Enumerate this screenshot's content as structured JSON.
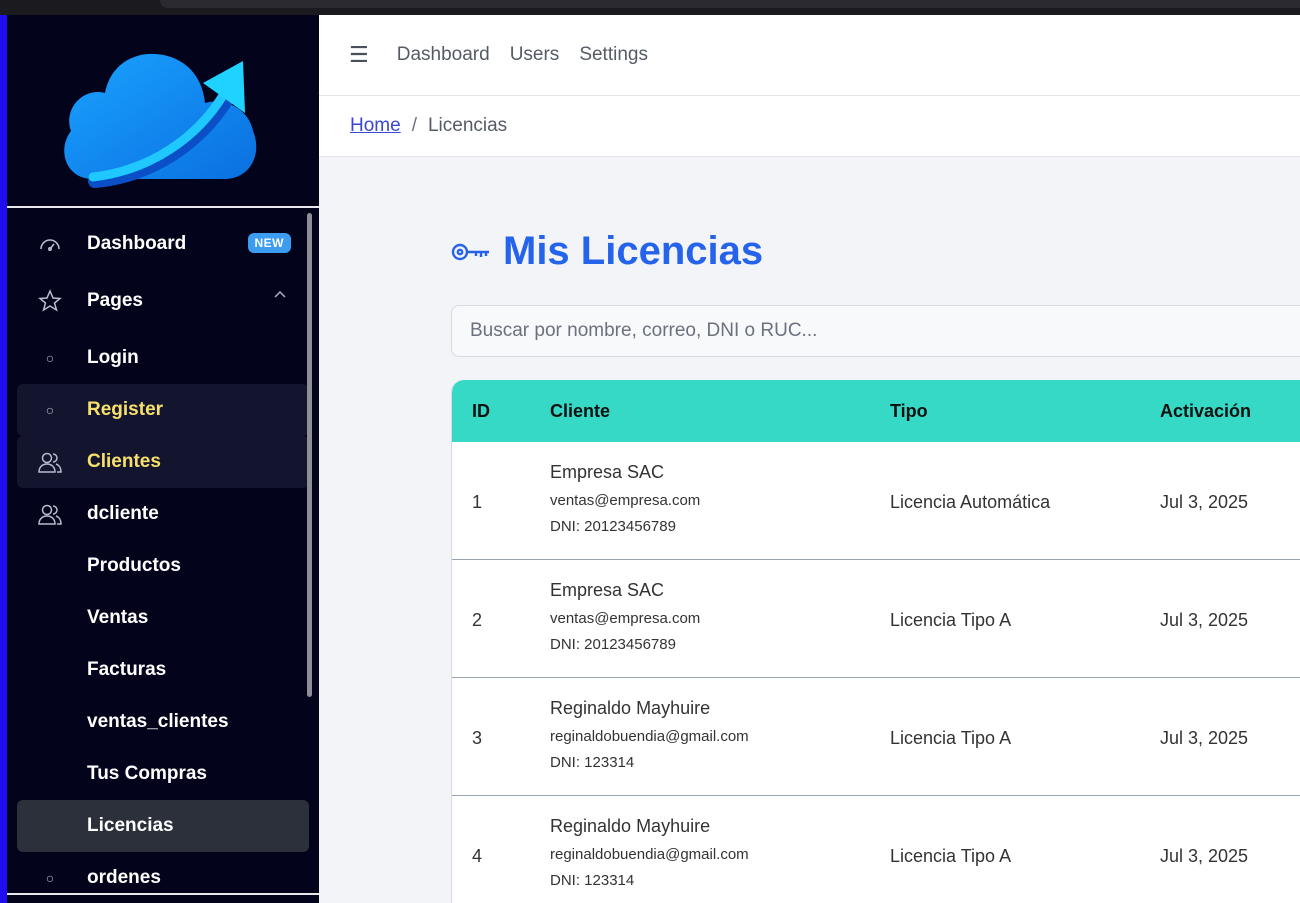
{
  "sidebar": {
    "items": [
      {
        "label": "Dashboard",
        "badge": "NEW",
        "icon": "gauge-icon"
      },
      {
        "label": "Pages",
        "icon": "star-icon",
        "expanded": true
      },
      {
        "label": "Login",
        "icon": "circle-dot"
      },
      {
        "label": "Register",
        "icon": "circle-dot",
        "state": "selected"
      },
      {
        "label": "Clientes",
        "icon": "users-icon",
        "state": "selected"
      },
      {
        "label": "dcliente",
        "icon": "users-icon"
      },
      {
        "label": "Productos"
      },
      {
        "label": "Ventas"
      },
      {
        "label": "Facturas"
      },
      {
        "label": "ventas_clientes"
      },
      {
        "label": "Tus Compras"
      },
      {
        "label": "Licencias",
        "state": "active"
      },
      {
        "label": "ordenes",
        "icon": "circle-dot"
      }
    ]
  },
  "topnav": {
    "links": [
      "Dashboard",
      "Users",
      "Settings"
    ]
  },
  "breadcrumb": {
    "home": "Home",
    "separator": "/",
    "current": "Licencias"
  },
  "page": {
    "title": "Mis Licencias"
  },
  "search": {
    "placeholder": "Buscar por nombre, correo, DNI o RUC..."
  },
  "table": {
    "headers": [
      "ID",
      "Cliente",
      "Tipo",
      "Activación"
    ],
    "rows": [
      {
        "id": "1",
        "name": "Empresa SAC",
        "email": "ventas@empresa.com",
        "dni": "DNI: 20123456789",
        "tipo": "Licencia Automática",
        "activacion": "Jul 3, 2025"
      },
      {
        "id": "2",
        "name": "Empresa SAC",
        "email": "ventas@empresa.com",
        "dni": "DNI: 20123456789",
        "tipo": "Licencia Tipo A",
        "activacion": "Jul 3, 2025"
      },
      {
        "id": "3",
        "name": "Reginaldo Mayhuire",
        "email": "reginaldobuendia@gmail.com",
        "dni": "DNI: 123314",
        "tipo": "Licencia Tipo A",
        "activacion": "Jul 3, 2025"
      },
      {
        "id": "4",
        "name": "Reginaldo Mayhuire",
        "email": "reginaldobuendia@gmail.com",
        "dni": "DNI: 123314",
        "tipo": "Licencia Tipo A",
        "activacion": "Jul 3, 2025"
      }
    ]
  },
  "colors": {
    "accent": "#2563eb",
    "table_header": "#36d9c5",
    "sidebar_bg": "#04031c",
    "selected_text": "#f7e06b"
  }
}
